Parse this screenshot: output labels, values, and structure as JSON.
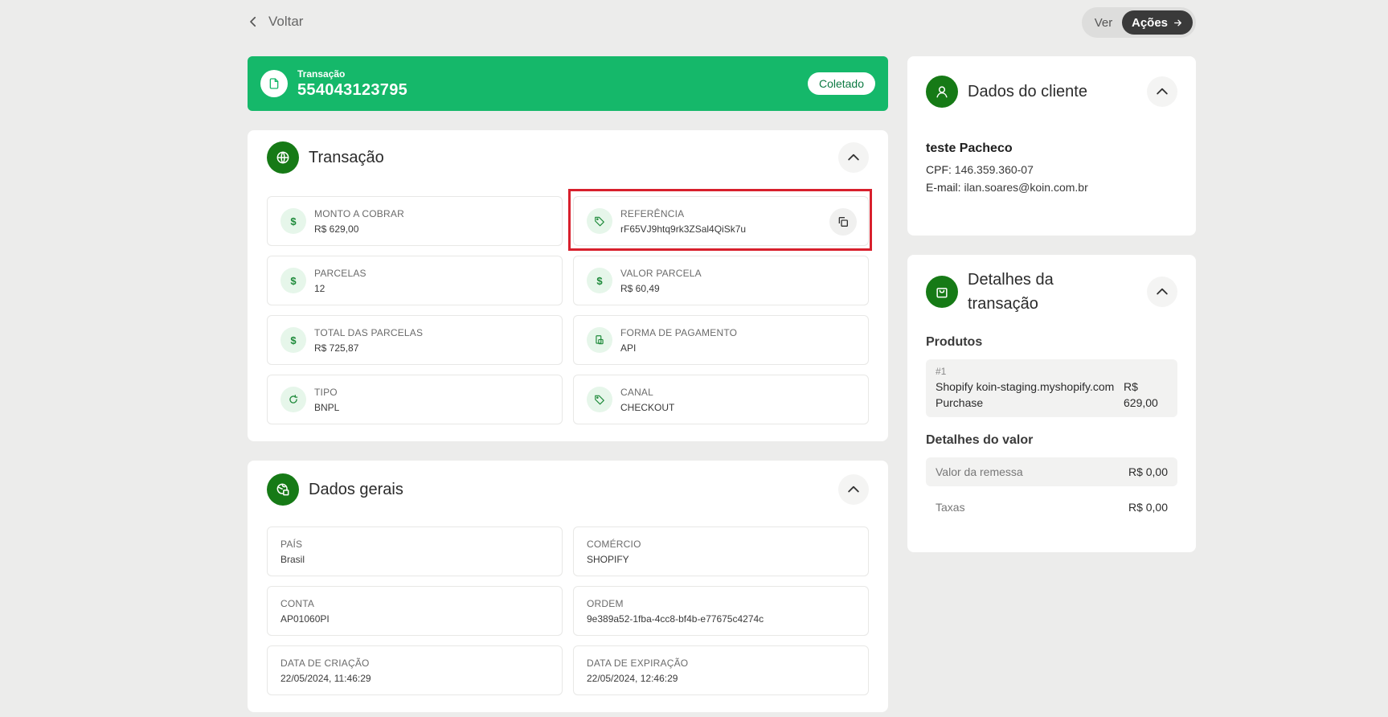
{
  "nav": {
    "back_label": "Voltar"
  },
  "toggle": {
    "ver_label": "Ver",
    "acoes_label": "Ações"
  },
  "banner": {
    "label": "Transação",
    "number": "554043123795",
    "status": "Coletado"
  },
  "transacao": {
    "title": "Transação",
    "fields": [
      {
        "label": "MONTO A COBRAR",
        "value": "R$ 629,00",
        "icon": "dollar-icon"
      },
      {
        "label": "REFERÊNCIA",
        "value": "rF65VJ9htq9rk3ZSal4QiSk7u",
        "icon": "tag-icon"
      },
      {
        "label": "PARCELAS",
        "value": "12",
        "icon": "dollar-icon"
      },
      {
        "label": "VALOR PARCELA",
        "value": "R$ 60,49",
        "icon": "dollar-icon"
      },
      {
        "label": "TOTAL DAS PARCELAS",
        "value": "R$ 725,87",
        "icon": "dollar-icon"
      },
      {
        "label": "FORMA DE PAGAMENTO",
        "value": "API",
        "icon": "payment-icon"
      },
      {
        "label": "TIPO",
        "value": "BNPL",
        "icon": "refresh-icon"
      },
      {
        "label": "CANAL",
        "value": "CHECKOUT",
        "icon": "tag-icon"
      }
    ]
  },
  "gerais": {
    "title": "Dados gerais",
    "fields": [
      {
        "label": "PAÍS",
        "value": "Brasil"
      },
      {
        "label": "COMÉRCIO",
        "value": "SHOPIFY"
      },
      {
        "label": "CONTA",
        "value": "AP01060PI"
      },
      {
        "label": "ORDEM",
        "value": "9e389a52-1fba-4cc8-bf4b-e77675c4274c"
      },
      {
        "label": "DATA DE CRIAÇÃO",
        "value": "22/05/2024, 11:46:29"
      },
      {
        "label": "DATA DE EXPIRAÇÃO",
        "value": "22/05/2024, 12:46:29"
      }
    ]
  },
  "cliente": {
    "title": "Dados do cliente",
    "name": "teste Pacheco",
    "cpf_label": "CPF:",
    "cpf": "146.359.360-07",
    "email_label": "E-mail:",
    "email": "ilan.soares@koin.com.br"
  },
  "detalhes": {
    "title_line1": "Detalhes da",
    "title_line2": "transação",
    "produtos_title": "Produtos",
    "product_index": "#1",
    "product_name": "Shopify koin-staging.myshopify.com Purchase",
    "product_price": "R$ 629,00",
    "valor_title": "Detalhes do valor",
    "remessa_label": "Valor da remessa",
    "remessa_value": "R$ 0,00",
    "taxas_label": "Taxas",
    "taxas_value": "R$ 0,00"
  },
  "colors": {
    "brand_green": "#15b86a",
    "dark_green": "#167a16",
    "highlight_red": "#d8202d"
  }
}
